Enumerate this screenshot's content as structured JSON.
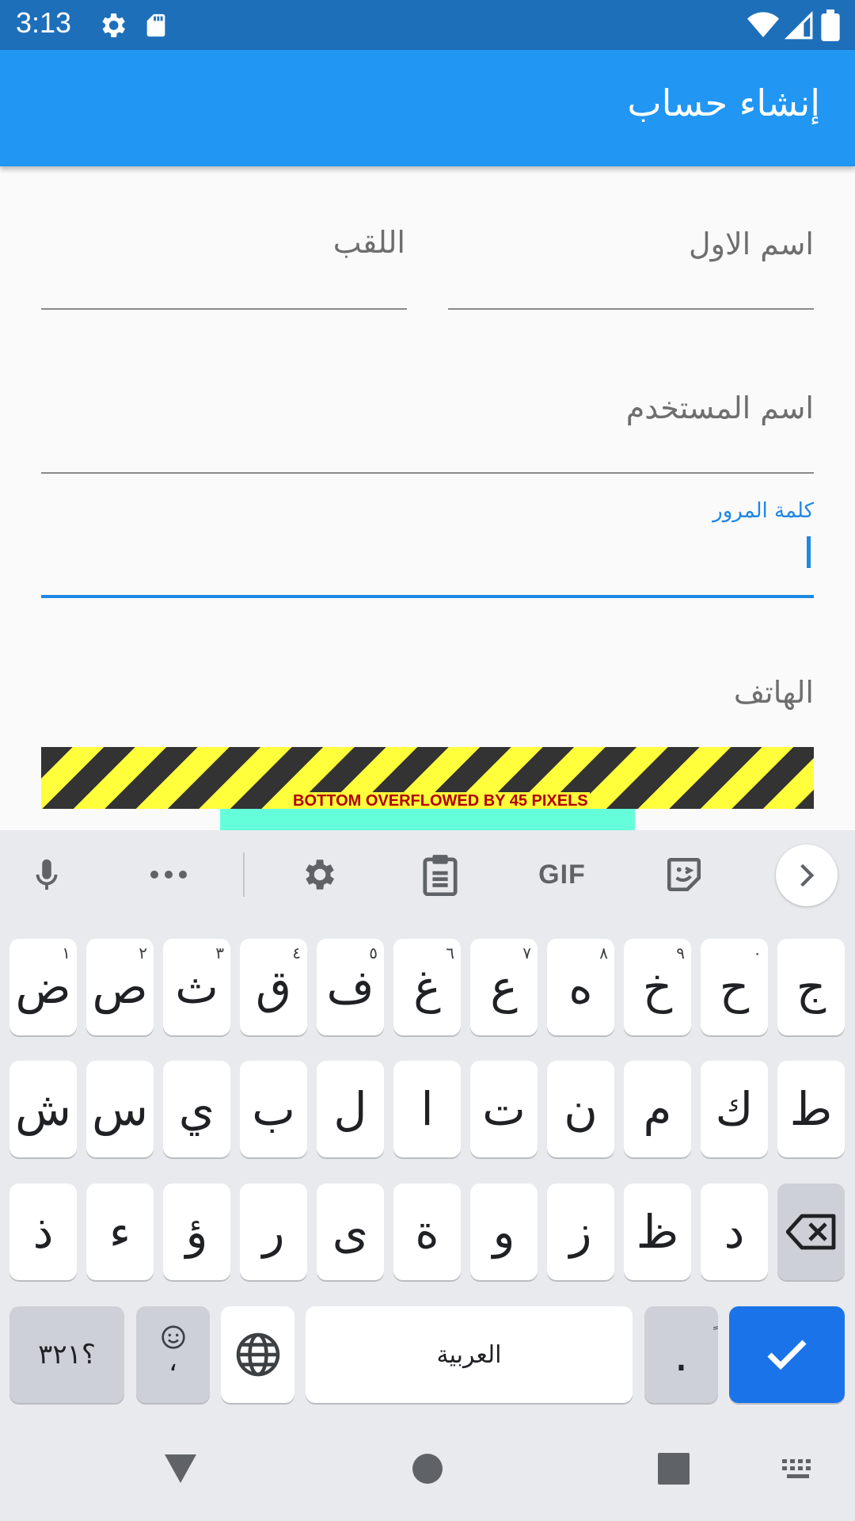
{
  "status_bar": {
    "time": "3:13",
    "icons": [
      "gear-icon",
      "sd-card-icon",
      "wifi-icon",
      "cell-signal-icon",
      "battery-icon"
    ]
  },
  "app_bar": {
    "title": "إنشاء حساب"
  },
  "form": {
    "first_name_label": "اسم الاول",
    "last_name_label": "اللقب",
    "username_label": "اسم المستخدم",
    "password_label": "كلمة المرور",
    "phone_label": "الهاتف"
  },
  "overflow_warning": "BOTTOM OVERFLOWED BY 45 PIXELS",
  "keyboard": {
    "toolbar": [
      "mic-icon",
      "more-dots-icon",
      "settings-icon",
      "clipboard-icon",
      "GIF",
      "sticker-icon",
      "chevron-right-icon"
    ],
    "gif_label": "GIF",
    "row1": [
      {
        "char": "ض",
        "hint": "١"
      },
      {
        "char": "ص",
        "hint": "٢"
      },
      {
        "char": "ث",
        "hint": "٣"
      },
      {
        "char": "ق",
        "hint": "٤"
      },
      {
        "char": "ف",
        "hint": "٥"
      },
      {
        "char": "غ",
        "hint": "٦"
      },
      {
        "char": "ع",
        "hint": "٧"
      },
      {
        "char": "ه",
        "hint": "٨"
      },
      {
        "char": "خ",
        "hint": "٩"
      },
      {
        "char": "ح",
        "hint": "٠"
      },
      {
        "char": "ج",
        "hint": ""
      }
    ],
    "row2": [
      "ش",
      "س",
      "ي",
      "ب",
      "ل",
      "ا",
      "ت",
      "ن",
      "م",
      "ك",
      "ط"
    ],
    "row3": [
      "ذ",
      "ء",
      "ؤ",
      "ر",
      "ى",
      "ة",
      "و",
      "ز",
      "ظ",
      "د"
    ],
    "symbols_label": "؟٣٢١",
    "emoji_comma": "،",
    "space_label": "العربية",
    "period_label": ".",
    "period_hint": "ٍ",
    "colors": {
      "accent": "#1a73e8",
      "app_bar": "#2196f3",
      "status_bar": "#1e6fba"
    }
  }
}
